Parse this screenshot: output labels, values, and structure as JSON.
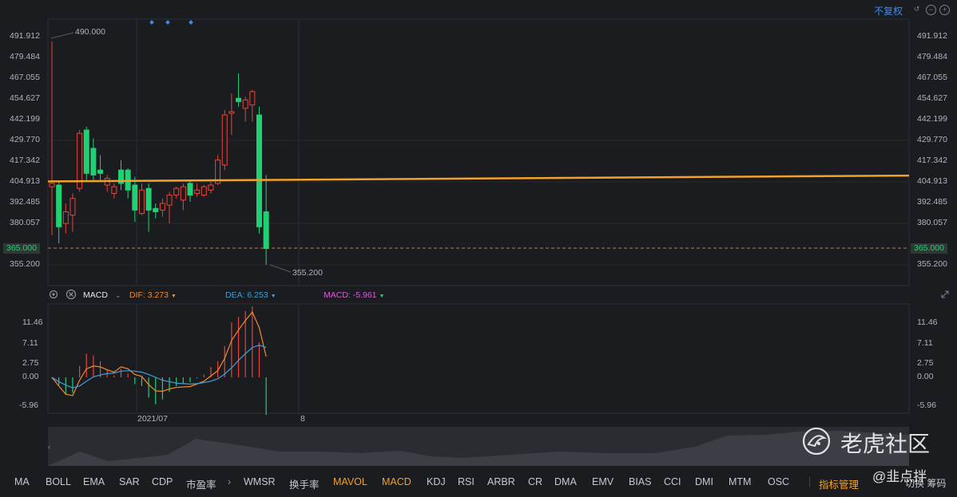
{
  "toolbar": {
    "adjust_label": "不复权",
    "icons": [
      "reset-icon",
      "zoom-out-icon",
      "zoom-in-icon"
    ]
  },
  "price_axis": {
    "left_labels": [
      "491.912",
      "479.484",
      "467.055",
      "454.627",
      "442.199",
      "429.770",
      "417.342",
      "404.913",
      "392.485",
      "380.057",
      "355.200"
    ],
    "right_labels": [
      "491.912",
      "479.484",
      "467.055",
      "454.627",
      "442.199",
      "429.770",
      "417.342",
      "404.913",
      "392.485",
      "380.057",
      "355.200"
    ],
    "highlight_price": "365.000"
  },
  "annotations": {
    "high": "490.000",
    "low": "355.200"
  },
  "macd_header": {
    "name": "MACD",
    "dif": "DIF: 3.273",
    "dea": "DEA: 6.253",
    "macd": "MACD: -5.961"
  },
  "macd_axis": {
    "left_labels": [
      "11.46",
      "7.11",
      "2.75",
      "0.00",
      "-5.96"
    ],
    "right_labels": [
      "11.46",
      "7.11",
      "2.75",
      "0.00",
      "-5.96"
    ]
  },
  "time_axis": {
    "labels": [
      "2021/07",
      "8"
    ]
  },
  "indicators": [
    "MA",
    "BOLL",
    "EMA",
    "SAR",
    "CDP",
    "市盈率",
    "WMSR",
    "换手率",
    "MAVOL",
    "MACD",
    "KDJ",
    "RSI",
    "ARBR",
    "CR",
    "DMA",
    "EMV",
    "BIAS",
    "CCI",
    "DMI",
    "MTM",
    "OSC"
  ],
  "active_indicators": [
    "MAVOL",
    "MACD"
  ],
  "manage_label": "指标管理",
  "partial_label": "切换 筹码",
  "watermark": {
    "title": "老虎社区",
    "user": "@韭点拌"
  },
  "colors": {
    "up": "#e8453c",
    "down": "#1fd173",
    "ma_line": "#f2a12c",
    "dif": "#f58a2b",
    "dea": "#3ca0dc",
    "accent": "#3d8bf2"
  },
  "chart_data": {
    "type": "candlestick",
    "y_range": [
      355.2,
      491.912
    ],
    "candles": [
      {
        "o": 402,
        "h": 489,
        "l": 373,
        "c": 404
      },
      {
        "o": 403,
        "h": 405,
        "l": 368,
        "c": 378
      },
      {
        "o": 380,
        "h": 392,
        "l": 374,
        "c": 387
      },
      {
        "o": 385,
        "h": 398,
        "l": 375,
        "c": 395
      },
      {
        "o": 401,
        "h": 436,
        "l": 399,
        "c": 434
      },
      {
        "o": 436,
        "h": 438,
        "l": 406,
        "c": 410
      },
      {
        "o": 425,
        "h": 431,
        "l": 406,
        "c": 409
      },
      {
        "o": 412,
        "h": 421,
        "l": 406,
        "c": 410
      },
      {
        "o": 403,
        "h": 409,
        "l": 399,
        "c": 407
      },
      {
        "o": 398,
        "h": 404,
        "l": 395,
        "c": 402
      },
      {
        "o": 412,
        "h": 418,
        "l": 400,
        "c": 404
      },
      {
        "o": 412,
        "h": 413,
        "l": 395,
        "c": 400
      },
      {
        "o": 403,
        "h": 408,
        "l": 381,
        "c": 388
      },
      {
        "o": 386,
        "h": 404,
        "l": 385,
        "c": 400
      },
      {
        "o": 401,
        "h": 404,
        "l": 375,
        "c": 388
      },
      {
        "o": 389,
        "h": 392,
        "l": 383,
        "c": 387
      },
      {
        "o": 388,
        "h": 395,
        "l": 384,
        "c": 392
      },
      {
        "o": 391,
        "h": 399,
        "l": 380,
        "c": 397
      },
      {
        "o": 397,
        "h": 402,
        "l": 395,
        "c": 401
      },
      {
        "o": 394,
        "h": 404,
        "l": 388,
        "c": 402
      },
      {
        "o": 404,
        "h": 406,
        "l": 393,
        "c": 397
      },
      {
        "o": 398,
        "h": 404,
        "l": 396,
        "c": 400
      },
      {
        "o": 397,
        "h": 403,
        "l": 396,
        "c": 402
      },
      {
        "o": 400,
        "h": 405,
        "l": 398,
        "c": 403
      },
      {
        "o": 404,
        "h": 421,
        "l": 403,
        "c": 418
      },
      {
        "o": 415,
        "h": 448,
        "l": 412,
        "c": 445
      },
      {
        "o": 446,
        "h": 458,
        "l": 433,
        "c": 447
      },
      {
        "o": 455,
        "h": 470,
        "l": 450,
        "c": 453
      },
      {
        "o": 449,
        "h": 456,
        "l": 441,
        "c": 454
      },
      {
        "o": 451,
        "h": 460,
        "l": 441,
        "c": 459
      },
      {
        "o": 445,
        "h": 450,
        "l": 374,
        "c": 378
      },
      {
        "o": 387,
        "h": 409,
        "l": 355.2,
        "c": 365
      }
    ],
    "ma": {
      "start": 405.2,
      "end": 408.7
    },
    "macd": {
      "y_range": [
        -5.96,
        14.5
      ],
      "dif": [
        0,
        -1.8,
        -3.5,
        -3.8,
        -0.6,
        1.8,
        2.4,
        2.2,
        1.6,
        1.1,
        2.2,
        1.8,
        0.6,
        0.2,
        -1.5,
        -2.8,
        -2.9,
        -2.4,
        -2.1,
        -2.0,
        -1.9,
        -1.4,
        -0.8,
        0.3,
        1.4,
        4.0,
        7.8,
        10.0,
        12.0,
        13.8,
        10.5,
        4.4
      ],
      "dea": [
        0,
        -0.9,
        -1.6,
        -2.2,
        -1.8,
        -0.8,
        0.1,
        0.5,
        0.8,
        0.9,
        1.3,
        1.4,
        1.3,
        1.1,
        0.6,
        0.0,
        -0.6,
        -0.9,
        -1.2,
        -1.3,
        -1.4,
        -1.3,
        -1.1,
        -0.8,
        -0.3,
        0.7,
        2.0,
        3.6,
        5.0,
        6.3,
        6.8,
        6.3
      ],
      "hist": [
        -0.2,
        -1.6,
        -3.6,
        -3.2,
        2.4,
        5.0,
        4.6,
        3.4,
        1.6,
        0.4,
        1.8,
        0.8,
        -1.4,
        -1.8,
        -4.2,
        -5.6,
        -4.6,
        -3.0,
        -1.8,
        -1.4,
        -1.0,
        -0.2,
        0.6,
        2.2,
        3.4,
        6.6,
        11.6,
        12.8,
        14.0,
        15.0,
        7.4,
        -7.8
      ]
    }
  }
}
